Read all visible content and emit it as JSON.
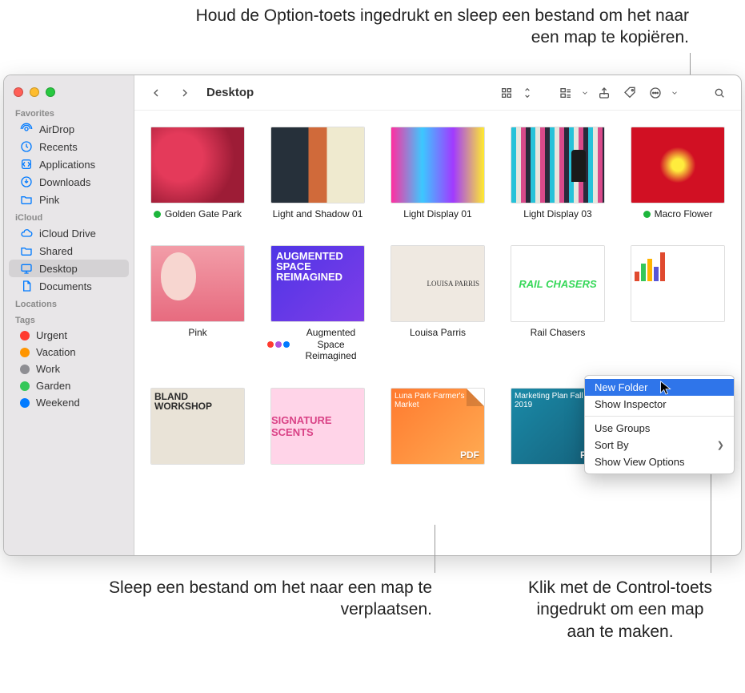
{
  "callouts": {
    "top": "Houd de Option-toets ingedrukt en sleep een bestand om het naar een map te kopiëren.",
    "bottom_left": "Sleep een bestand om het naar een map te verplaatsen.",
    "bottom_right": "Klik met de Control-toets ingedrukt om een map aan te maken."
  },
  "window": {
    "title": "Desktop"
  },
  "sidebar": {
    "sections": {
      "favorites": "Favorites",
      "icloud": "iCloud",
      "locations": "Locations",
      "tags": "Tags"
    },
    "favorites": [
      {
        "label": "AirDrop"
      },
      {
        "label": "Recents"
      },
      {
        "label": "Applications"
      },
      {
        "label": "Downloads"
      },
      {
        "label": "Pink"
      }
    ],
    "icloud": [
      {
        "label": "iCloud Drive"
      },
      {
        "label": "Shared"
      },
      {
        "label": "Desktop",
        "selected": true
      },
      {
        "label": "Documents"
      }
    ],
    "tags": [
      {
        "label": "Urgent",
        "color": "#ff3b30"
      },
      {
        "label": "Vacation",
        "color": "#ff9500"
      },
      {
        "label": "Work",
        "color": "#8e8e93"
      },
      {
        "label": "Garden",
        "color": "#34c759"
      },
      {
        "label": "Weekend",
        "color": "#007aff"
      }
    ]
  },
  "files": [
    {
      "label": "Golden Gate Park",
      "tag_green": true,
      "kind": "flowers"
    },
    {
      "label": "Light and Shadow 01",
      "kind": "light-shadow"
    },
    {
      "label": "Light Display 01",
      "kind": "light-display1"
    },
    {
      "label": "Light Display 03",
      "kind": "light-display3"
    },
    {
      "label": "Macro Flower",
      "tag_green": true,
      "kind": "macro"
    },
    {
      "label": "Pink",
      "kind": "pink"
    },
    {
      "label": "Augmented Space Reimagined",
      "multi_tag": true,
      "kind": "augmented"
    },
    {
      "label": "Louisa Parris",
      "kind": "louisa"
    },
    {
      "label": "Rail Chasers",
      "kind": "rail"
    },
    {
      "label": "",
      "kind": "chart"
    },
    {
      "label": "",
      "kind": "bland"
    },
    {
      "label": "",
      "kind": "scents"
    },
    {
      "label": "",
      "kind": "pdf1"
    },
    {
      "label": "",
      "kind": "pdf2"
    }
  ],
  "context_menu": {
    "items": [
      {
        "label": "New Folder",
        "highlight": true
      },
      {
        "label": "Show Inspector"
      },
      {
        "sep": true
      },
      {
        "label": "Use Groups"
      },
      {
        "label": "Sort By",
        "submenu": true
      },
      {
        "label": "Show View Options"
      }
    ]
  },
  "thumb_text": {
    "augmented": "AUGMENTED SPACE REIMAGINED",
    "louisa": "LOUISA PARRIS",
    "rail": "RAIL CHASERS",
    "bland": "BLAND WORKSHOP",
    "scents": "SIGNATURE SCENTS",
    "pdf1": "Luna Park Farmer's Market",
    "pdf2": "Marketing Plan Fall 2019"
  }
}
